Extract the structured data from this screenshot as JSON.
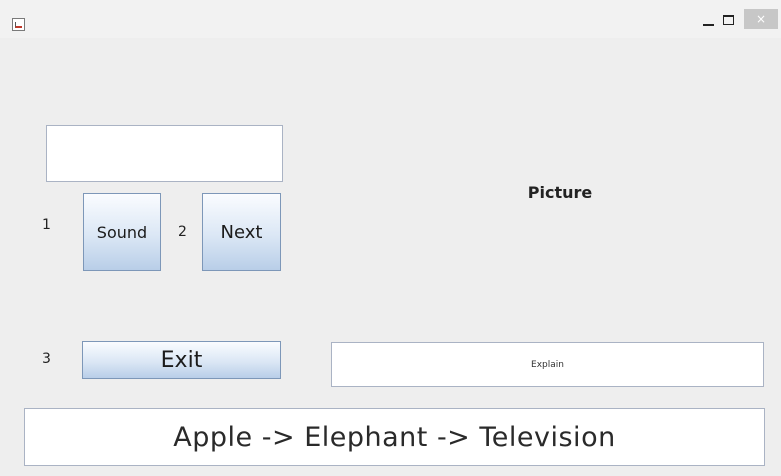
{
  "window": {
    "close_glyph": "×"
  },
  "controls": {
    "label_1": "1",
    "label_2": "2",
    "label_3": "3",
    "sound_button": "Sound",
    "next_button": "Next",
    "exit_button": "Exit",
    "input_value": ""
  },
  "display": {
    "picture_label": "Picture",
    "explain_text": "Explain",
    "output_text": "Apple -> Elephant -> Television"
  }
}
